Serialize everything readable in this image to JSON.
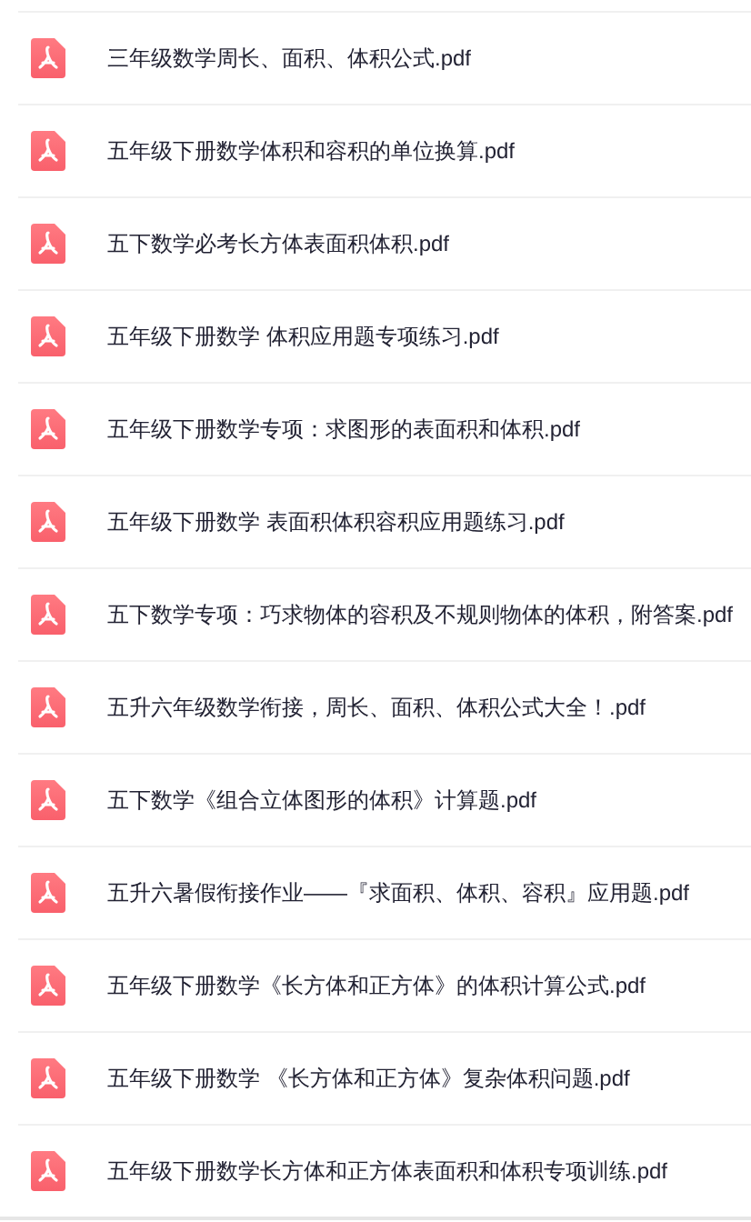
{
  "files": [
    {
      "name": "三年级数学周长、面积、体积公式.pdf"
    },
    {
      "name": "五年级下册数学体积和容积的单位换算.pdf"
    },
    {
      "name": "五下数学必考长方体表面积体积.pdf"
    },
    {
      "name": "五年级下册数学 体积应用题专项练习.pdf"
    },
    {
      "name": "五年级下册数学专项：求图形的表面积和体积.pdf"
    },
    {
      "name": "五年级下册数学 表面积体积容积应用题练习.pdf"
    },
    {
      "name": "五下数学专项：巧求物体的容积及不规则物体的体积，附答案.pdf"
    },
    {
      "name": "五升六年级数学衔接，周长、面积、体积公式大全！.pdf"
    },
    {
      "name": "五下数学《组合立体图形的体积》计算题.pdf"
    },
    {
      "name": "五升六暑假衔接作业——『求面积、体积、容积』应用题.pdf"
    },
    {
      "name": "五年级下册数学《长方体和正方体》的体积计算公式.pdf"
    },
    {
      "name": "五年级下册数学 《长方体和正方体》复杂体积问题.pdf"
    },
    {
      "name": "五年级下册数学长方体和正方体表面积和体积专项训练.pdf"
    }
  ]
}
